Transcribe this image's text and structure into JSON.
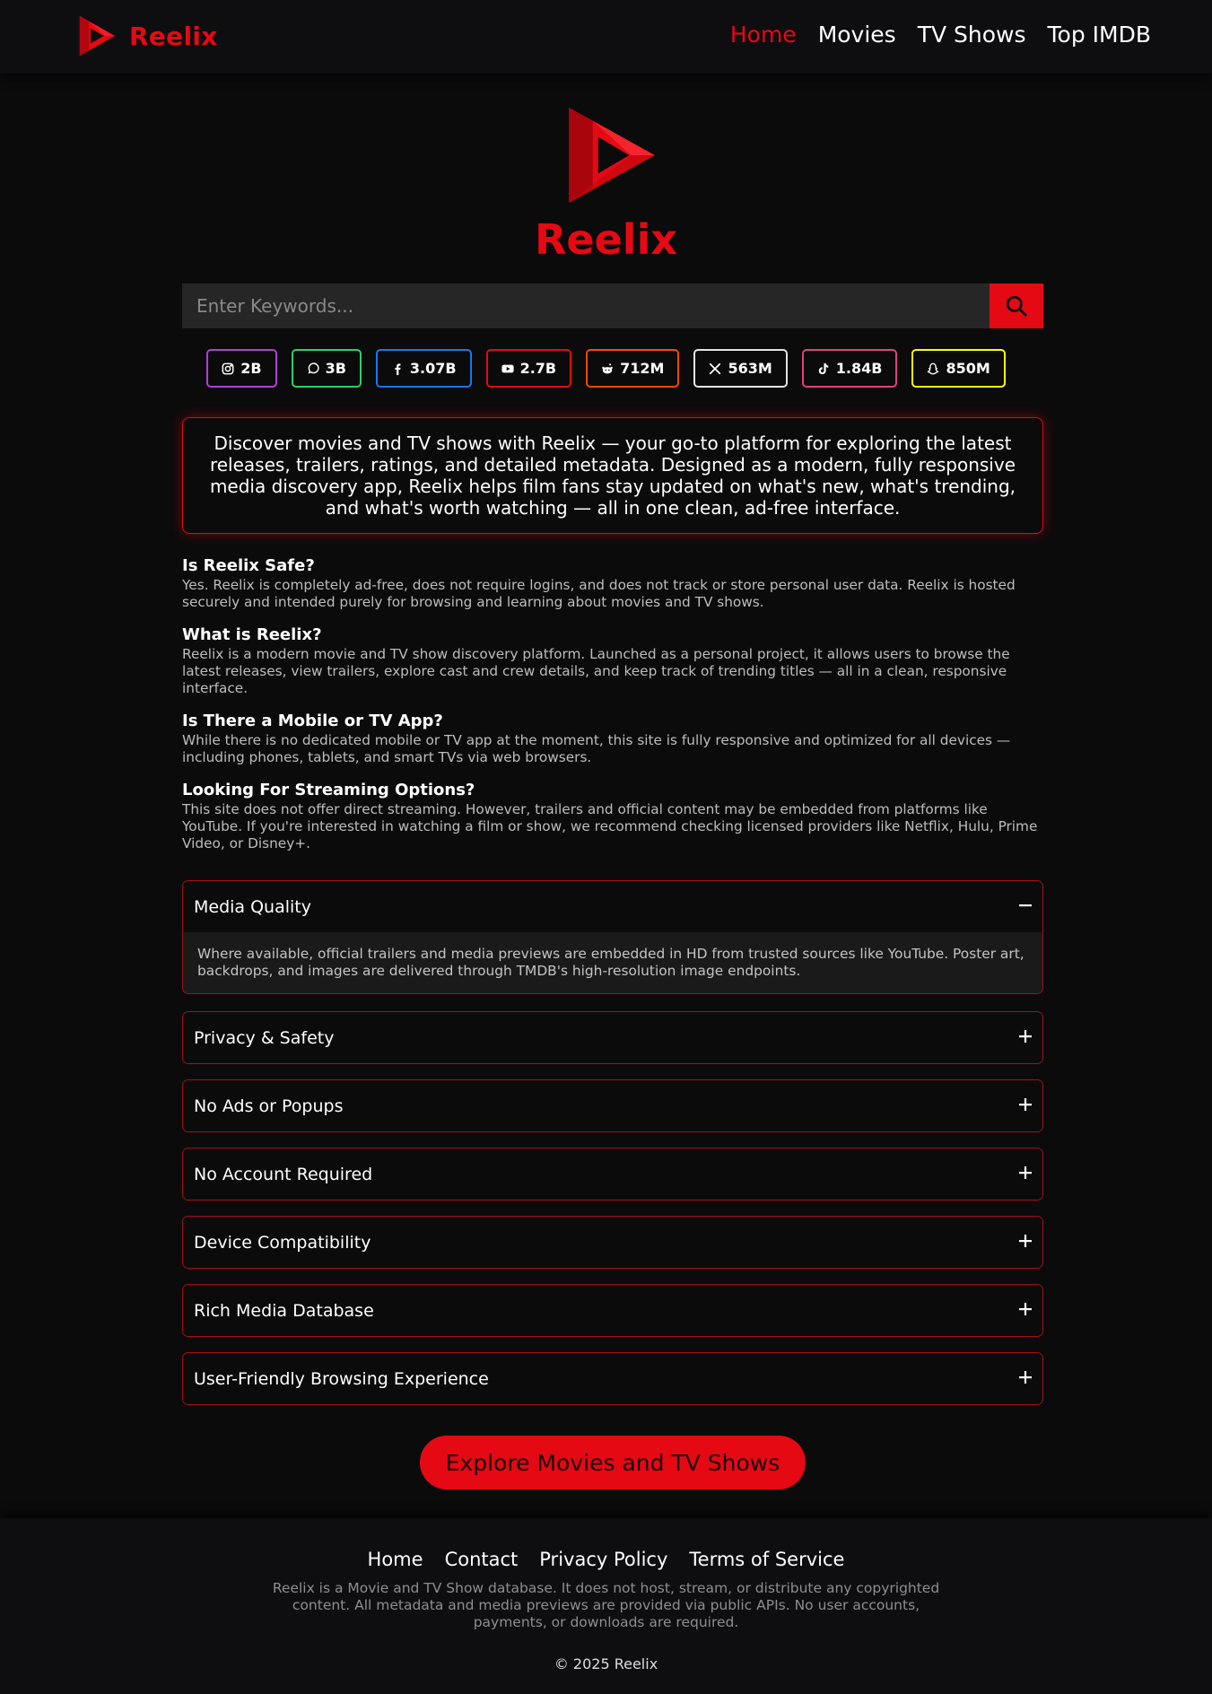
{
  "brand": {
    "name": "Reelix",
    "color": "#e50914"
  },
  "nav": {
    "items": [
      "Home",
      "Movies",
      "TV Shows",
      "Top IMDB"
    ],
    "active": "Home"
  },
  "hero": {
    "title": "Reelix"
  },
  "search": {
    "placeholder": "Enter Keywords...",
    "icon": "search-icon"
  },
  "socials": [
    {
      "icon": "instagram-icon",
      "count": "2B",
      "border": "#b33ed8"
    },
    {
      "icon": "whatsapp-icon",
      "count": "3B",
      "border": "#25d366"
    },
    {
      "icon": "facebook-icon",
      "count": "3.07B",
      "border": "#1877f2"
    },
    {
      "icon": "youtube-icon",
      "count": "2.7B",
      "border": "#e50914"
    },
    {
      "icon": "reddit-icon",
      "count": "712M",
      "border": "#ff4500"
    },
    {
      "icon": "x-icon",
      "count": "563M",
      "border": "#e5e5e5"
    },
    {
      "icon": "tiktok-icon",
      "count": "1.84B",
      "border": "#69c9d0"
    },
    {
      "icon": "snapchat-icon",
      "count": "850M",
      "border": "#fffc00"
    }
  ],
  "intro": "Discover movies and TV shows with Reelix — your go-to platform for exploring the latest releases, trailers, ratings, and detailed metadata. Designed as a modern, fully responsive media discovery app, Reelix helps film fans stay updated on what's new, what's trending, and what's worth watching — all in one clean, ad-free interface.",
  "faq": [
    {
      "q": "Is Reelix Safe?",
      "a": "Yes. Reelix is completely ad-free, does not require logins, and does not track or store personal user data. Reelix is hosted securely and intended purely for browsing and learning about movies and TV shows."
    },
    {
      "q": "What is Reelix?",
      "a": "Reelix is a modern movie and TV show discovery platform. Launched as a personal project, it allows users to browse the latest releases, view trailers, explore cast and crew details, and keep track of trending titles — all in a clean, responsive interface."
    },
    {
      "q": "Is There a Mobile or TV App?",
      "a": "While there is no dedicated mobile or TV app at the moment, this site is fully responsive and optimized for all devices — including phones, tablets, and smart TVs via web browsers."
    },
    {
      "q": "Looking For Streaming Options?",
      "a": "This site does not offer direct streaming. However, trailers and official content may be embedded from platforms like YouTube. If you're interested in watching a film or show, we recommend checking licensed providers like Netflix, Hulu, Prime Video, or Disney+."
    }
  ],
  "accordions": [
    {
      "title": "Media Quality",
      "expanded": true,
      "toggle": "−",
      "body": "Where available, official trailers and media previews are embedded in HD from trusted sources like YouTube. Poster art, backdrops, and images are delivered through TMDB's high-resolution image endpoints."
    },
    {
      "title": "Privacy & Safety",
      "expanded": false,
      "toggle": "+"
    },
    {
      "title": "No Ads or Popups",
      "expanded": false,
      "toggle": "+"
    },
    {
      "title": "No Account Required",
      "expanded": false,
      "toggle": "+"
    },
    {
      "title": "Device Compatibility",
      "expanded": false,
      "toggle": "+"
    },
    {
      "title": "Rich Media Database",
      "expanded": false,
      "toggle": "+"
    },
    {
      "title": "User-Friendly Browsing Experience",
      "expanded": false,
      "toggle": "+"
    }
  ],
  "cta": "Explore Movies and TV Shows",
  "footer": {
    "links": [
      "Home",
      "Contact",
      "Privacy Policy",
      "Terms of Service"
    ],
    "disclaimer": "Reelix is a Movie and TV Show database. It does not host, stream, or distribute any copyrighted content. All metadata and media previews are provided via public APIs. No user accounts, payments, or downloads are required.",
    "copyright": "© 2025 Reelix"
  }
}
